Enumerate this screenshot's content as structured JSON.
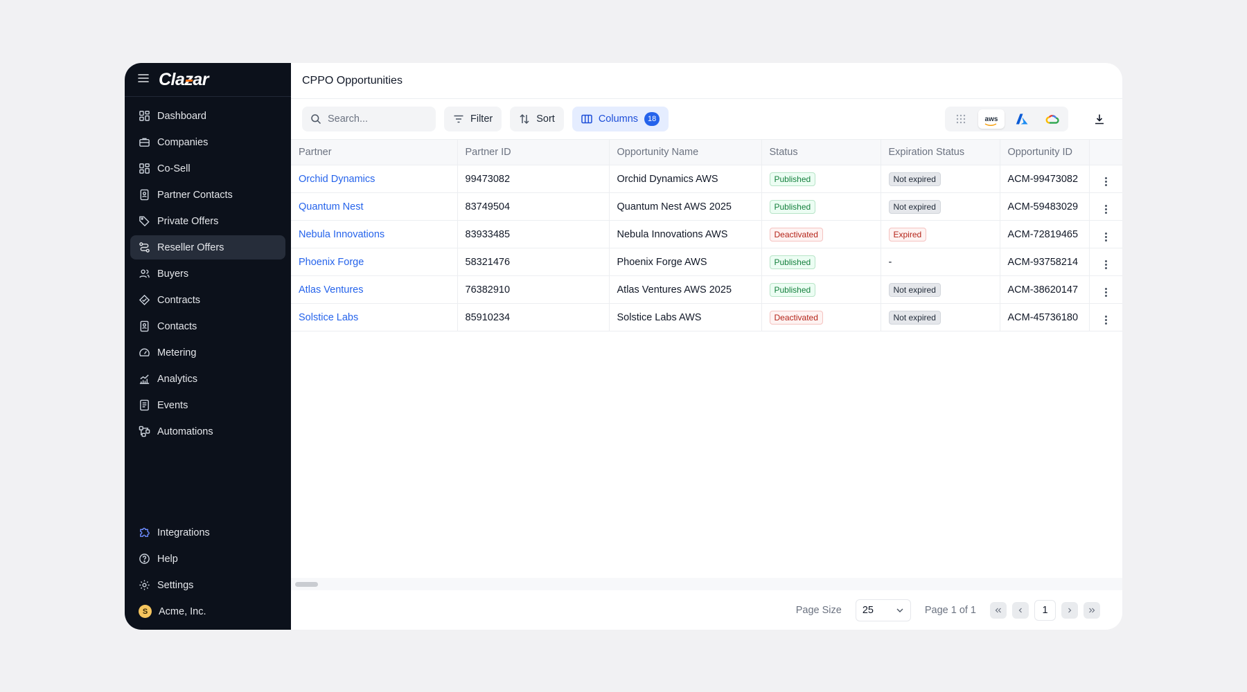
{
  "brand": {
    "logo_prefix": "Cla",
    "logo_z": "z",
    "logo_suffix": "ar",
    "accent": "#f97316"
  },
  "sidebar": {
    "items": [
      {
        "label": "Dashboard",
        "icon": "dashboard-icon"
      },
      {
        "label": "Companies",
        "icon": "briefcase-icon"
      },
      {
        "label": "Co-Sell",
        "icon": "grid-icon"
      },
      {
        "label": "Partner Contacts",
        "icon": "contact-card-icon"
      },
      {
        "label": "Private Offers",
        "icon": "tag-icon"
      },
      {
        "label": "Reseller Offers",
        "icon": "route-icon",
        "active": true
      },
      {
        "label": "Buyers",
        "icon": "users-icon"
      },
      {
        "label": "Contracts",
        "icon": "handshake-icon"
      },
      {
        "label": "Contacts",
        "icon": "contact-card-icon"
      },
      {
        "label": "Metering",
        "icon": "gauge-icon"
      },
      {
        "label": "Analytics",
        "icon": "bar-chart-icon"
      },
      {
        "label": "Events",
        "icon": "document-list-icon"
      },
      {
        "label": "Automations",
        "icon": "workflow-icon"
      }
    ],
    "bottom": [
      {
        "label": "Integrations",
        "icon": "puzzle-icon"
      },
      {
        "label": "Help",
        "icon": "help-circle-icon"
      },
      {
        "label": "Settings",
        "icon": "gear-icon"
      },
      {
        "label": "Acme, Inc.",
        "avatar_initial": "S"
      }
    ]
  },
  "page": {
    "title": "CPPO Opportunities"
  },
  "toolbar": {
    "search_placeholder": "Search...",
    "filter_label": "Filter",
    "sort_label": "Sort",
    "columns_label": "Columns",
    "columns_count": "18",
    "clouds": {
      "aws": "aws",
      "selected": "aws"
    }
  },
  "table": {
    "headers": [
      "Partner",
      "Partner ID",
      "Opportunity Name",
      "Status",
      "Expiration Status",
      "Opportunity ID"
    ],
    "rows": [
      {
        "partner": "Orchid Dynamics",
        "partner_id": "99473082",
        "opportunity": "Orchid Dynamics AWS",
        "status": "Published",
        "expiration": "Not expired",
        "opp_id": "ACM-99473082"
      },
      {
        "partner": "Quantum Nest",
        "partner_id": "83749504",
        "opportunity": "Quantum Nest AWS 2025",
        "status": "Published",
        "expiration": "Not expired",
        "opp_id": "ACM-59483029"
      },
      {
        "partner": "Nebula Innovations",
        "partner_id": "83933485",
        "opportunity": "Nebula Innovations AWS",
        "status": "Deactivated",
        "expiration": "Expired",
        "opp_id": "ACM-72819465"
      },
      {
        "partner": "Phoenix Forge",
        "partner_id": "58321476",
        "opportunity": "Phoenix Forge AWS",
        "status": "Published",
        "expiration": "-",
        "opp_id": "ACM-93758214"
      },
      {
        "partner": "Atlas Ventures",
        "partner_id": "76382910",
        "opportunity": "Atlas Ventures AWS 2025",
        "status": "Published",
        "expiration": "Not expired",
        "opp_id": "ACM-38620147"
      },
      {
        "partner": "Solstice Labs",
        "partner_id": "85910234",
        "opportunity": "Solstice Labs AWS",
        "status": "Deactivated",
        "expiration": "Not expired",
        "opp_id": "ACM-45736180"
      }
    ]
  },
  "pagination": {
    "page_size_label": "Page Size",
    "page_size_value": "25",
    "page_info": "Page 1 of 1",
    "current_page": "1"
  },
  "colors": {
    "sidebar_bg": "#0c111b",
    "link": "#2563eb",
    "published": "#15803d",
    "deactivated": "#b42318"
  }
}
